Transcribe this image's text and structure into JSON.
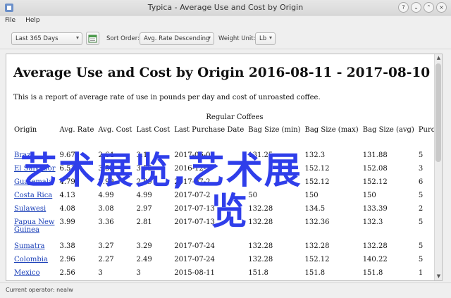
{
  "window": {
    "title": "Typica - Average Use and Cost by Origin",
    "menu": [
      "File",
      "Help"
    ]
  },
  "toolbar": {
    "date_range": "Last 365 Days",
    "sort_label": "Sort Order:",
    "sort_value": "Avg. Rate Descending",
    "weight_label": "Weight Unit:",
    "weight_value": "Lb"
  },
  "report": {
    "title": "Average Use and Cost by Origin 2016-08-11 - 2017-08-10",
    "intro": "This is a report of average rate of use in pounds per day and cost of unroasted coffee.",
    "caption": "Regular Coffees",
    "columns": [
      "Origin",
      "Avg. Rate",
      "Avg. Cost",
      "Last Cost",
      "Last Purchase Date",
      "Bag Size (min)",
      "Bag Size (max)",
      "Bag Size (avg)",
      "Purchases"
    ],
    "rows": [
      {
        "origin": "Brazil",
        "rate": "9.67",
        "avg_cost": "2.64",
        "last_cost": "3.1",
        "date": "2017-06-01",
        "min": "131.25",
        "max": "132.3",
        "avg": "131.88",
        "purchases": "5"
      },
      {
        "origin": "El Salvador",
        "rate": "6.51",
        "avg_cost": "3.55",
        "last_cost": "3.55",
        "date": "2016-12-",
        "min": "",
        "max": "152.12",
        "avg": "152.08",
        "purchases": "3"
      },
      {
        "origin": "Guatemala",
        "rate": "4.79",
        "avg_cost": "2.99",
        "last_cost": "2.89",
        "date": "2017-07-2",
        "min": "",
        "max": "152.12",
        "avg": "152.12",
        "purchases": "6"
      },
      {
        "origin": "Costa Rica",
        "rate": "4.13",
        "avg_cost": "4.99",
        "last_cost": "4.99",
        "date": "2017-07-2",
        "min": "50",
        "max": "150",
        "avg": "150",
        "purchases": "5"
      },
      {
        "origin": "Sulawesi",
        "rate": "4.08",
        "avg_cost": "3.08",
        "last_cost": "2.97",
        "date": "2017-07-13",
        "min": "132.28",
        "max": "134.5",
        "avg": "133.39",
        "purchases": "2"
      },
      {
        "origin": "Papua New Guinea",
        "rate": "3.99",
        "avg_cost": "3.36",
        "last_cost": "2.81",
        "date": "2017-07-13",
        "min": "132.28",
        "max": "132.36",
        "avg": "132.3",
        "purchases": "5"
      },
      {
        "origin": "Sumatra",
        "rate": "3.38",
        "avg_cost": "3.27",
        "last_cost": "3.29",
        "date": "2017-07-24",
        "min": "132.28",
        "max": "132.28",
        "avg": "132.28",
        "purchases": "5"
      },
      {
        "origin": "Colombia",
        "rate": "2.96",
        "avg_cost": "2.27",
        "last_cost": "2.49",
        "date": "2017-07-24",
        "min": "132.28",
        "max": "152.12",
        "avg": "140.22",
        "purchases": "5"
      },
      {
        "origin": "Mexico",
        "rate": "2.56",
        "avg_cost": "3",
        "last_cost": "3",
        "date": "2015-08-11",
        "min": "151.8",
        "max": "151.8",
        "avg": "151.8",
        "purchases": "1"
      }
    ]
  },
  "overlay": {
    "line1": "艺术展览,艺术展",
    "line2": "览"
  },
  "status": {
    "text": "Current operator: nealw"
  }
}
